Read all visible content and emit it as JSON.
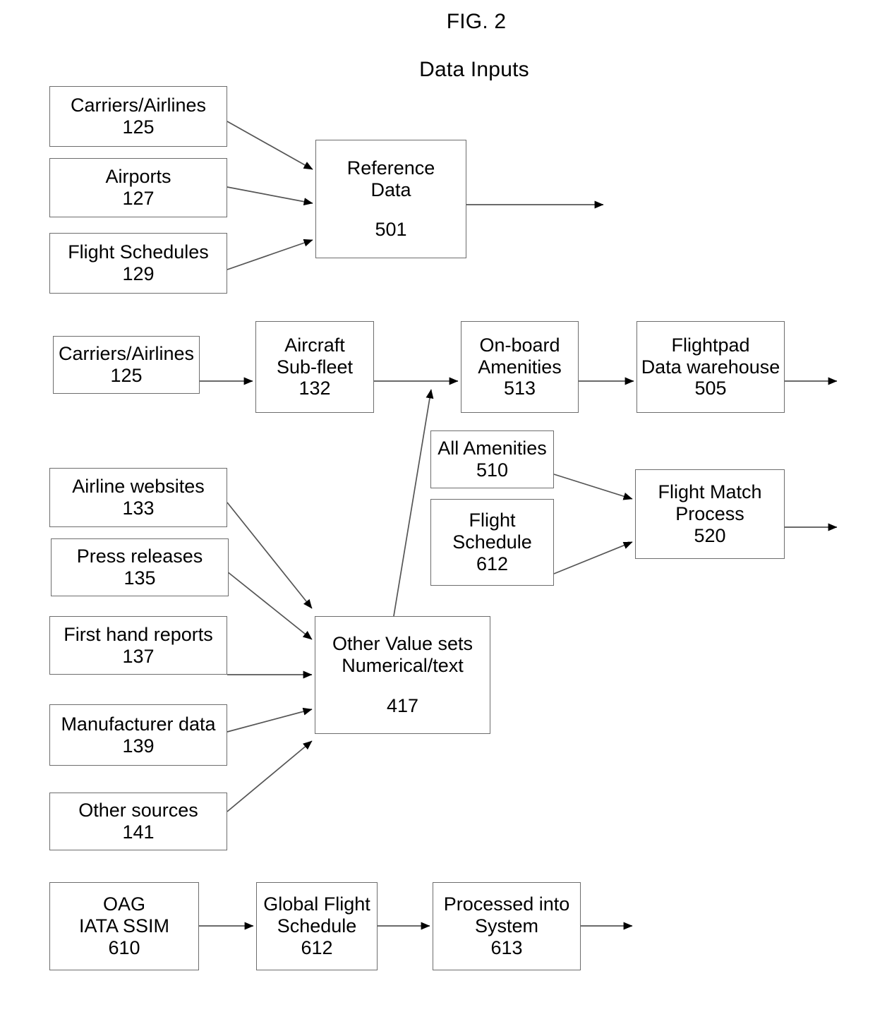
{
  "figure": {
    "label": "FIG. 2",
    "subtitle": "Data Inputs"
  },
  "nodes": {
    "carriers_airlines_top": {
      "line1": "Carriers/Airlines",
      "ref": "125"
    },
    "airports": {
      "line1": "Airports",
      "ref": "127"
    },
    "flight_schedules": {
      "line1": "Flight Schedules",
      "ref": "129"
    },
    "reference_data": {
      "line1": "Reference",
      "line2": "Data",
      "ref": "501"
    },
    "carriers_airlines_mid": {
      "line1": "Carriers/Airlines",
      "ref": "125"
    },
    "aircraft_subfleet": {
      "line1": "Aircraft",
      "line2": "Sub-fleet",
      "ref": "132"
    },
    "onboard_amenities": {
      "line1": "On-board",
      "line2": "Amenities",
      "ref": "513"
    },
    "flightpad_warehouse": {
      "line1": "Flightpad",
      "line2": "Data warehouse",
      "ref": "505"
    },
    "all_amenities": {
      "line1": "All Amenities",
      "ref": "510"
    },
    "flight_schedule_612": {
      "line1": "Flight",
      "line2": "Schedule",
      "ref": "612"
    },
    "flight_match_process": {
      "line1": "Flight Match",
      "line2": "Process",
      "ref": "520"
    },
    "airline_websites": {
      "line1": "Airline websites",
      "ref": "133"
    },
    "press_releases": {
      "line1": "Press releases",
      "ref": "135"
    },
    "first_hand_reports": {
      "line1": "First hand reports",
      "ref": "137"
    },
    "manufacturer_data": {
      "line1": "Manufacturer data",
      "ref": "139"
    },
    "other_sources": {
      "line1": "Other sources",
      "ref": "141"
    },
    "other_value_sets": {
      "line1": "Other Value sets",
      "line2": "Numerical/text",
      "ref": "417"
    },
    "oag_iata_ssim": {
      "line1": "OAG",
      "line2": "IATA SSIM",
      "ref": "610"
    },
    "global_flight_schedule": {
      "line1": "Global Flight",
      "line2": "Schedule",
      "ref": "612"
    },
    "processed_into_system": {
      "line1": "Processed into",
      "line2": "System",
      "ref": "613"
    }
  },
  "colors": {
    "stroke": "#6d6d6d",
    "edge": "#555555",
    "arrow": "#000000",
    "text": "#000000",
    "background": "#ffffff"
  },
  "edges": [
    {
      "from": "carriers_airlines_top",
      "to": "reference_data"
    },
    {
      "from": "airports",
      "to": "reference_data"
    },
    {
      "from": "flight_schedules",
      "to": "reference_data"
    },
    {
      "from": "reference_data",
      "to": "output-right"
    },
    {
      "from": "carriers_airlines_mid",
      "to": "aircraft_subfleet"
    },
    {
      "from": "aircraft_subfleet",
      "to": "onboard_amenities"
    },
    {
      "from": "other_value_sets",
      "to": "onboard_amenities"
    },
    {
      "from": "onboard_amenities",
      "to": "flightpad_warehouse"
    },
    {
      "from": "flightpad_warehouse",
      "to": "output-right"
    },
    {
      "from": "all_amenities",
      "to": "flight_match_process"
    },
    {
      "from": "flight_schedule_612",
      "to": "flight_match_process"
    },
    {
      "from": "flight_match_process",
      "to": "output-right"
    },
    {
      "from": "airline_websites",
      "to": "other_value_sets"
    },
    {
      "from": "press_releases",
      "to": "other_value_sets"
    },
    {
      "from": "first_hand_reports",
      "to": "other_value_sets"
    },
    {
      "from": "manufacturer_data",
      "to": "other_value_sets"
    },
    {
      "from": "other_sources",
      "to": "other_value_sets"
    },
    {
      "from": "oag_iata_ssim",
      "to": "global_flight_schedule"
    },
    {
      "from": "global_flight_schedule",
      "to": "processed_into_system"
    },
    {
      "from": "processed_into_system",
      "to": "output-right"
    }
  ]
}
